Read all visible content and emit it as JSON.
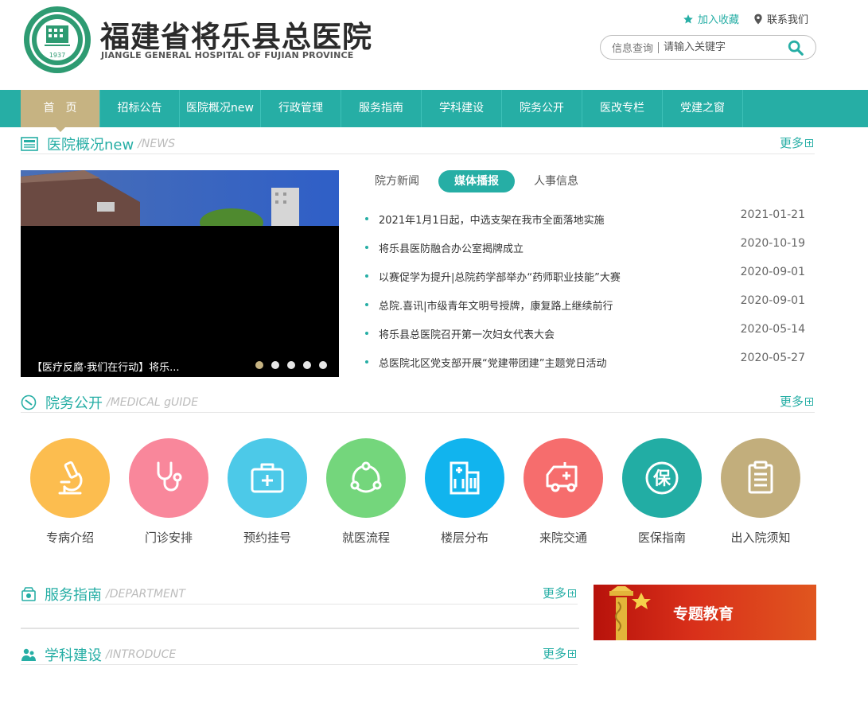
{
  "header": {
    "seal_text": "福建省将乐县总医院",
    "seal_year": "1937",
    "logo_cn": "福建省将乐县总医院",
    "logo_en": "JIANGLE GENERAL HOSPITAL OF FUJIAN PROVINCE",
    "favorite_label": "加入收藏",
    "contact_label": "联系我们",
    "search_label": "信息查询",
    "search_placeholder": "请输入关键字"
  },
  "nav": {
    "items": [
      "首　页",
      "招标公告",
      "医院概况new",
      "行政管理",
      "服务指南",
      "学科建设",
      "院务公开",
      "医改专栏",
      "党建之窗"
    ],
    "active_index": 0
  },
  "news_section": {
    "title": "医院概况new",
    "subtitle": "/NEWS",
    "more_label": "更多",
    "slider_caption": "【医疗反腐·我们在行动】将乐...",
    "slide_count": 5,
    "active_slide": 0,
    "tabs": [
      "院方新闻",
      "媒体播报",
      "人事信息"
    ],
    "active_tab": 1,
    "items": [
      {
        "title": "2021年1月1日起，中选支架在我市全面落地实施",
        "date": "2021-01-21"
      },
      {
        "title": "将乐县医防融合办公室揭牌成立",
        "date": "2020-10-19"
      },
      {
        "title": "以赛促学为提升|总院药学部举办“药师职业技能”大赛",
        "date": "2020-09-01"
      },
      {
        "title": "总院.喜讯|市级青年文明号授牌，康复路上继续前行",
        "date": "2020-09-01"
      },
      {
        "title": "将乐县总医院召开第一次妇女代表大会",
        "date": "2020-05-14"
      },
      {
        "title": "总医院北区党支部开展“党建带团建”主题党日活动",
        "date": "2020-05-27"
      }
    ]
  },
  "medical_section": {
    "title": "院务公开",
    "subtitle": "/MEDICAL gUIDE",
    "more_label": "更多",
    "items": [
      {
        "label": "专病介绍",
        "icon": "microscope-icon",
        "color": "#fcbd4f"
      },
      {
        "label": "门诊安排",
        "icon": "stethoscope-icon",
        "color": "#f9879b"
      },
      {
        "label": "预约挂号",
        "icon": "medical-kit-icon",
        "color": "#4cc9e8"
      },
      {
        "label": "就医流程",
        "icon": "process-cycle-icon",
        "color": "#74d67c"
      },
      {
        "label": "楼层分布",
        "icon": "building-icon",
        "color": "#11b4ee"
      },
      {
        "label": "来院交通",
        "icon": "ambulance-icon",
        "color": "#f66d6d"
      },
      {
        "label": "医保指南",
        "icon": "insurance-icon",
        "color": "#22ada4"
      },
      {
        "label": "出入院须知",
        "icon": "clipboard-icon",
        "color": "#c2ae7c"
      }
    ]
  },
  "department_section": {
    "title": "服务指南",
    "subtitle": "/DEPARTMENT",
    "more_label": "更多"
  },
  "introduce_section": {
    "title": "学科建设",
    "subtitle": "/INTRODUCE",
    "more_label": "更多"
  },
  "banner": {
    "text": "专题教育"
  },
  "colors": {
    "primary": "#26aea5",
    "active_nav": "#c6b382"
  }
}
